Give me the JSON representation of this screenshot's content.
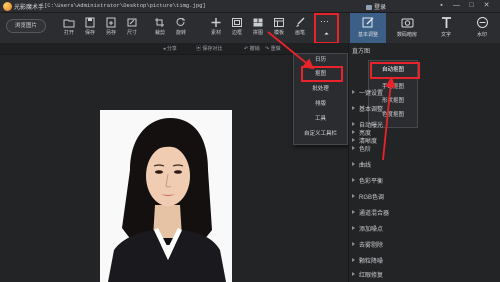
{
  "titlebar": {
    "app_name": "光影魔术手",
    "path": "[C:\\Users\\Administrator\\Desktop\\picture\\timg.jpg]",
    "login_label": "登录",
    "controls": [
      "▪",
      "—",
      "□",
      "✕"
    ]
  },
  "toolbar": {
    "browse_label": "浏览图片",
    "tools": [
      {
        "label": "打开",
        "icon": "folder-icon"
      },
      {
        "label": "保存",
        "icon": "save-icon"
      },
      {
        "label": "另存",
        "icon": "save-as-icon"
      },
      {
        "label": "尺寸",
        "icon": "resize-icon"
      },
      {
        "label": "裁剪",
        "icon": "crop-icon"
      },
      {
        "label": "旋转",
        "icon": "rotate-icon"
      },
      {
        "label": "素材",
        "icon": "material-icon"
      },
      {
        "label": "边框",
        "icon": "frame-icon"
      },
      {
        "label": "拼图",
        "icon": "collage-icon"
      },
      {
        "label": "模板",
        "icon": "template-icon"
      },
      {
        "label": "画笔",
        "icon": "brush-icon"
      }
    ],
    "more_label": "···"
  },
  "tabs": [
    {
      "label": "基本调整",
      "icon": "adjust-icon",
      "active": true
    },
    {
      "label": "数码暗房",
      "icon": "camera-icon",
      "active": false
    },
    {
      "label": "文字",
      "icon": "text-icon",
      "active": false
    },
    {
      "label": "水印",
      "icon": "watermark-icon",
      "active": false
    }
  ],
  "subbar": {
    "share": "分享",
    "save_compare": "保存对比",
    "undo": "撤销",
    "redo": "重做"
  },
  "dropdown": {
    "items": [
      "日历",
      "抠图",
      "批处理",
      "排版",
      "工具",
      "自定义工具栏"
    ],
    "highlighted": "抠图"
  },
  "panel": {
    "header": "直方图",
    "submenu": [
      "自动抠图",
      "手动抠图",
      "形状抠图",
      "色度抠图"
    ],
    "items": [
      "一键设置",
      "基本调整",
      "自动曝光",
      "亮度",
      "清晰度",
      "色阶",
      "曲线",
      "色彩平衡",
      "RGB色调",
      "通道混合器",
      "添加噪点",
      "去雾剔除",
      "颗粒降噪",
      "红眼修复"
    ]
  },
  "colors": {
    "highlight": "#e8232a",
    "active_tab": "#3b5f86"
  }
}
